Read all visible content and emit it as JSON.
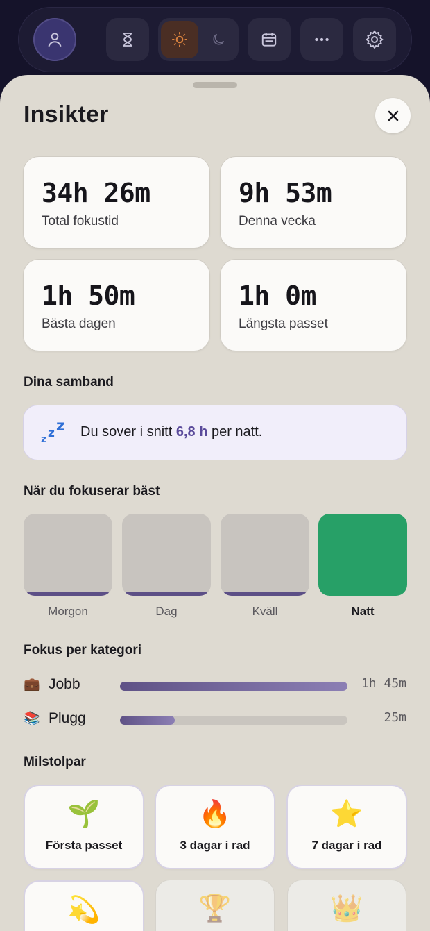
{
  "toolbar": {
    "icons": [
      "user-icon",
      "hourglass-icon",
      "sun-icon",
      "moon-icon",
      "calendar-icon",
      "more-icon",
      "gear-icon"
    ]
  },
  "sheet": {
    "title": "Insikter"
  },
  "stats": [
    {
      "value": "34h 26m",
      "label": "Total fokustid"
    },
    {
      "value": "9h 53m",
      "label": "Denna vecka"
    },
    {
      "value": "1h 50m",
      "label": "Bästa dagen"
    },
    {
      "value": "1h 0m",
      "label": "Längsta passet"
    }
  ],
  "correlations": {
    "heading": "Dina samband",
    "text_before": "Du sover i snitt ",
    "highlight": "6,8 h",
    "text_after": " per natt."
  },
  "best_time": {
    "heading": "När du fokuserar bäst",
    "slots": [
      {
        "label": "Morgon",
        "active": false
      },
      {
        "label": "Dag",
        "active": false
      },
      {
        "label": "Kväll",
        "active": false
      },
      {
        "label": "Natt",
        "active": true
      }
    ]
  },
  "categories": {
    "heading": "Fokus per kategori",
    "items": [
      {
        "icon": "💼",
        "name": "Jobb",
        "time": "1h 45m",
        "share": 1.0
      },
      {
        "icon": "📚",
        "name": "Plugg",
        "time": "25m",
        "share": 0.24
      }
    ]
  },
  "milestones": {
    "heading": "Milstolpar",
    "items": [
      {
        "emoji": "🌱",
        "label": "Första passet",
        "unlocked": true
      },
      {
        "emoji": "🔥",
        "label": "3 dagar i rad",
        "unlocked": true
      },
      {
        "emoji": "⭐",
        "label": "7 dagar i rad",
        "unlocked": true
      },
      {
        "emoji": "💫",
        "label": "",
        "unlocked": true
      },
      {
        "emoji": "🏆",
        "label": "",
        "unlocked": false
      },
      {
        "emoji": "👑",
        "label": "",
        "unlocked": false
      }
    ]
  },
  "colors": {
    "accent": "#5a4a9a",
    "night_active": "#27a067",
    "sheet_bg": "#dedad1"
  }
}
